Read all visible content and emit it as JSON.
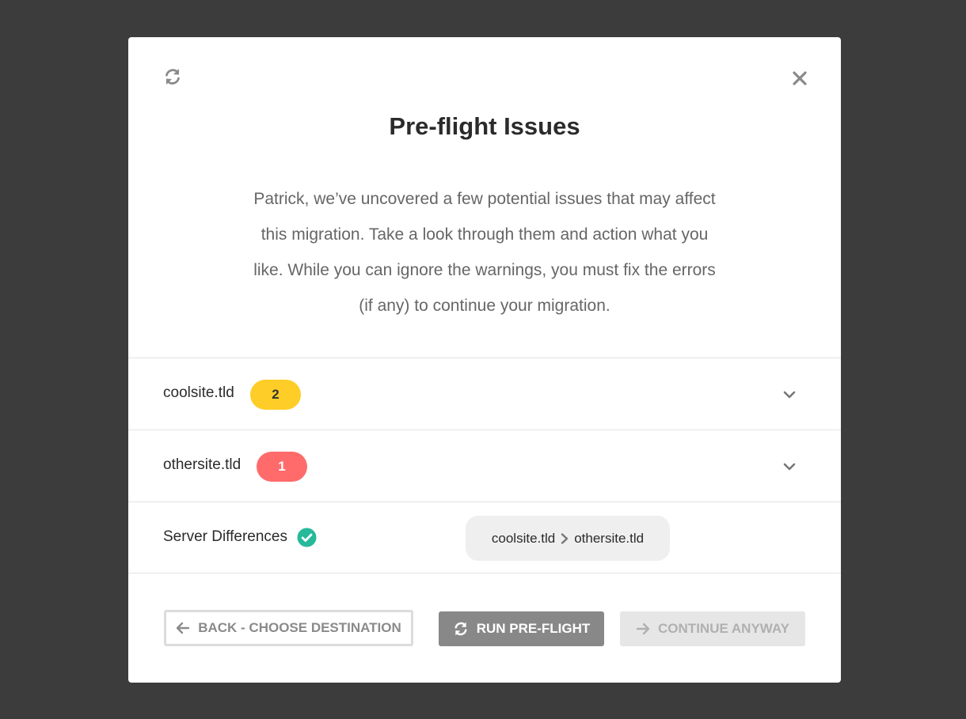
{
  "modal": {
    "title": "Pre-flight Issues",
    "description": "Patrick, we’ve uncovered a few potential issues that may affect this migration. Take a look through them and action what you like. While you can ignore the warnings, you must fix the errors (if any) to continue your migration."
  },
  "rows": [
    {
      "label": "coolsite.tld",
      "count": "2",
      "badge_color": "#ffcd27"
    },
    {
      "label": "othersite.tld",
      "count": "1",
      "badge_color": "#ff6b6b"
    }
  ],
  "server_differences": {
    "label": "Server Differences",
    "status": "ok",
    "source": "coolsite.tld",
    "destination": "othersite.tld"
  },
  "buttons": {
    "back": "BACK - CHOOSE DESTINATION",
    "run": "RUN PRE-FLIGHT",
    "continue": "CONTINUE ANYWAY"
  },
  "colors": {
    "overlay": "#3c3c3c",
    "success": "#26b99a",
    "warning": "#ffcd27",
    "error": "#ff6b6b"
  },
  "icons": [
    "refresh-icon",
    "close-icon",
    "chevron-down-icon",
    "check-circle-icon",
    "arrow-left-icon",
    "arrow-right-icon",
    "chevron-right-icon"
  ]
}
